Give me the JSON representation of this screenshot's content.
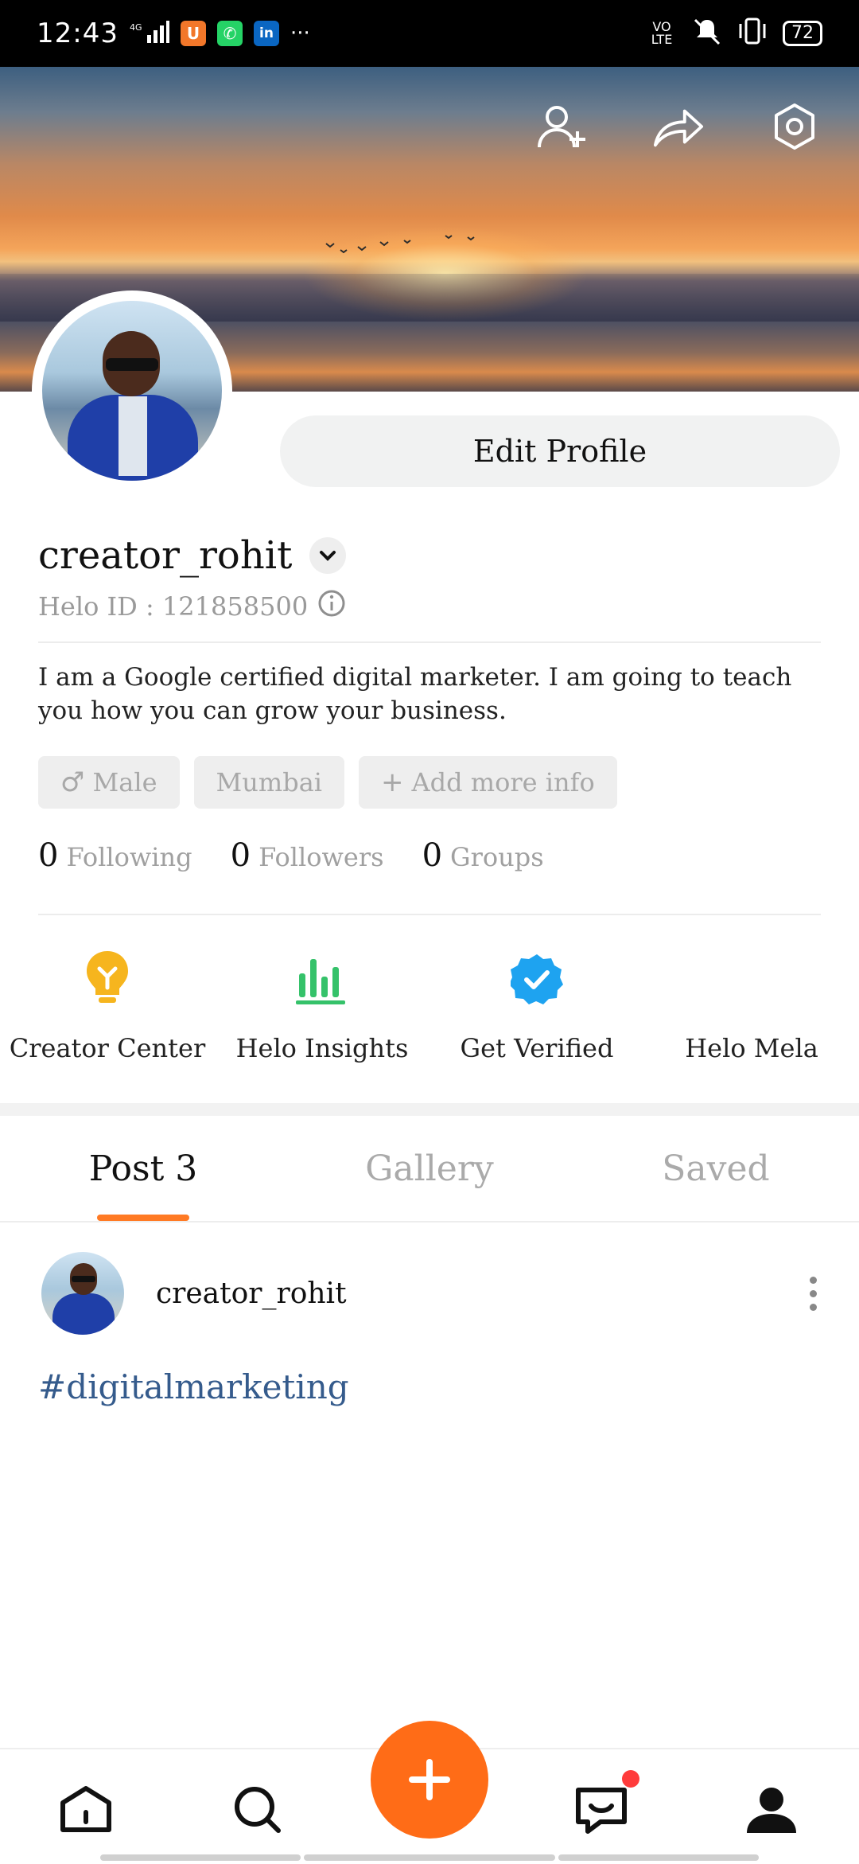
{
  "status_bar": {
    "time": "12:43",
    "network": "4G",
    "volte": "VO LTE",
    "battery": "72",
    "more": "···",
    "apps": [
      "uc-browser-icon",
      "whatsapp-icon",
      "linkedin-icon"
    ]
  },
  "header": {
    "icons": [
      "add-friend-icon",
      "share-icon",
      "settings-icon"
    ]
  },
  "profile": {
    "edit_label": "Edit Profile",
    "username": "creator_rohit",
    "helo_id": "Helo ID : 121858500",
    "bio": "I am a Google certified digital marketer. I am going to teach you how you can grow your business.",
    "chips": {
      "gender_symbol": "♂",
      "gender": "Male",
      "city": "Mumbai",
      "add_symbol": "+",
      "add_more": "Add more info"
    },
    "counts": {
      "following_num": "0",
      "following_label": "Following",
      "followers_num": "0",
      "followers_label": "Followers",
      "groups_num": "0",
      "groups_label": "Groups"
    }
  },
  "shortcuts": [
    {
      "label": "Creator Center",
      "icon": "bulb-icon",
      "color": "#f6b51e"
    },
    {
      "label": "Helo Insights",
      "icon": "insights-bars-icon",
      "color": "#35c26a"
    },
    {
      "label": "Get Verified",
      "icon": "verified-badge-icon",
      "color": "#1ea3f0"
    },
    {
      "label": "Helo Mela",
      "icon": "",
      "color": ""
    }
  ],
  "tabs": [
    {
      "label": "Post 3",
      "active": true
    },
    {
      "label": "Gallery",
      "active": false
    },
    {
      "label": "Saved",
      "active": false
    }
  ],
  "post": {
    "author": "creator_rohit",
    "hashtag": "#digitalmarketing"
  },
  "bottom_nav": {
    "items": [
      "home-icon",
      "search-icon",
      "create-post-button",
      "messages-icon",
      "profile-icon"
    ],
    "accent": "#ff6c17",
    "notification_dot": "#ff3b3b"
  }
}
